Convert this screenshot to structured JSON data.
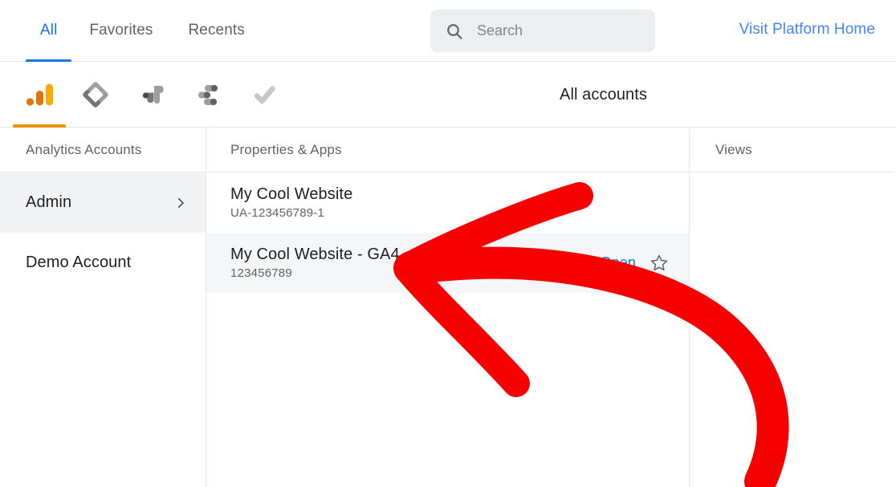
{
  "header": {
    "tabs": [
      {
        "label": "All",
        "active": true
      },
      {
        "label": "Favorites",
        "active": false
      },
      {
        "label": "Recents",
        "active": false
      }
    ],
    "search": {
      "placeholder": "Search",
      "value": "",
      "icon": "search-icon"
    },
    "platform_link": "Visit Platform Home",
    "link_color": "#4285f4",
    "active_tab_color": "#1a73e8"
  },
  "product_bar": {
    "title": "All accounts",
    "active_underline_color": "#e8960c",
    "products": [
      {
        "icon": "google-analytics-icon",
        "active": true
      },
      {
        "icon": "google-tag-manager-icon",
        "active": false
      },
      {
        "icon": "google-optimize-icon",
        "active": false
      },
      {
        "icon": "google-data-studio-icon",
        "active": false
      },
      {
        "icon": "google-surveys-checkmark-icon",
        "active": false
      }
    ]
  },
  "columns": {
    "accounts": {
      "header": "Analytics Accounts",
      "rows": [
        {
          "name": "Admin",
          "selected": true,
          "chevron": "chevron-right-icon"
        },
        {
          "name": "Demo Account",
          "selected": false,
          "chevron": ""
        }
      ]
    },
    "properties": {
      "header": "Properties & Apps",
      "rows": [
        {
          "name": "My Cool Website",
          "id": "UA-123456789-1",
          "selected": false,
          "open_label": "",
          "star": false
        },
        {
          "name": "My Cool Website - GA4",
          "id": "123456789",
          "selected": true,
          "open_label": "Open",
          "star": true
        }
      ]
    },
    "views": {
      "header": "Views",
      "rows": []
    }
  },
  "annotation": {
    "type": "hand-drawn-arrow",
    "color": "#f70000",
    "points_to": "My Cool Website - GA4"
  }
}
